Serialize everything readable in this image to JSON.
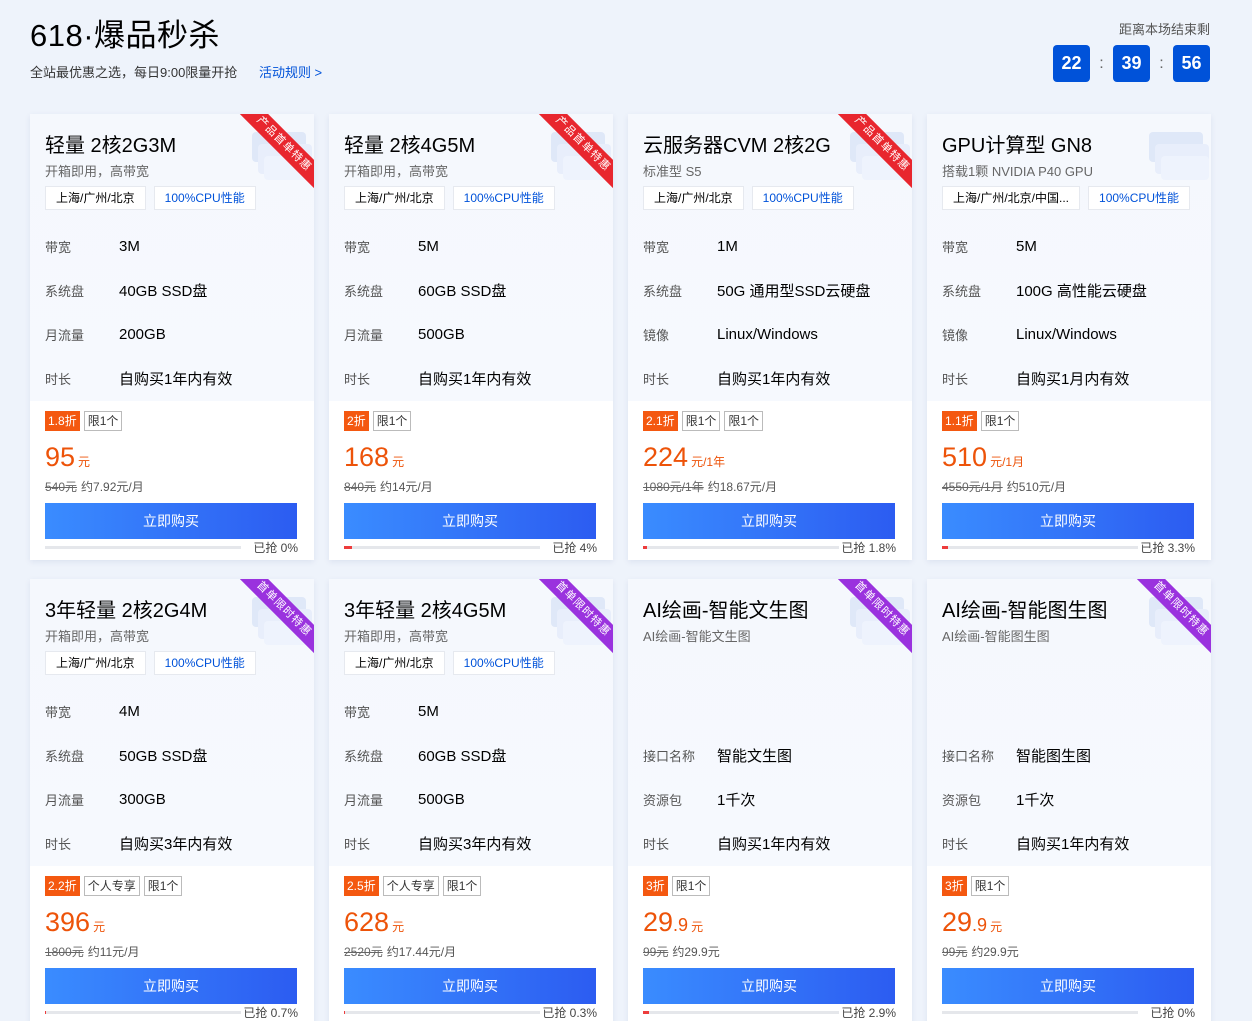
{
  "header": {
    "title": "618·爆品秒杀",
    "subtitle": "全站最优惠之选，每日9:00限量开抢",
    "rules_link": "活动规则 >",
    "countdown_label": "距离本场结束剩",
    "countdown": [
      "22",
      "39",
      "56"
    ],
    "countdown_sep": ":"
  },
  "labels": {
    "buy": "立即购买"
  },
  "cards": [
    {
      "title": "轻量 2核2G3M",
      "subtitle": "开箱即用，高带宽",
      "tags": [
        "上海/广州/北京",
        "100%CPU性能"
      ],
      "ribbon": "产品首单特惠",
      "ribbon_color": "red",
      "specs": [
        [
          "带宽",
          "3M"
        ],
        [
          "系统盘",
          "40GB SSD盘"
        ],
        [
          "月流量",
          "200GB"
        ],
        [
          "时长",
          "自购买1年内有效"
        ]
      ],
      "discount": "1.8折",
      "limits": [
        "限1个"
      ],
      "price": "95",
      "price_dec": "",
      "unit": "元",
      "orig": "540元",
      "monthly": "约7.92元/月",
      "sold_text": "已抢 0%",
      "sold_pct": 0
    },
    {
      "title": "轻量 2核4G5M",
      "subtitle": "开箱即用，高带宽",
      "tags": [
        "上海/广州/北京",
        "100%CPU性能"
      ],
      "ribbon": "产品首单特惠",
      "ribbon_color": "red",
      "specs": [
        [
          "带宽",
          "5M"
        ],
        [
          "系统盘",
          "60GB SSD盘"
        ],
        [
          "月流量",
          "500GB"
        ],
        [
          "时长",
          "自购买1年内有效"
        ]
      ],
      "discount": "2折",
      "limits": [
        "限1个"
      ],
      "price": "168",
      "price_dec": "",
      "unit": "元",
      "orig": "840元",
      "monthly": "约14元/月",
      "sold_text": "已抢 4%",
      "sold_pct": 4
    },
    {
      "title": "云服务器CVM 2核2G",
      "subtitle": "标准型 S5",
      "tags": [
        "上海/广州/北京",
        "100%CPU性能"
      ],
      "ribbon": "产品首单特惠",
      "ribbon_color": "red",
      "specs": [
        [
          "带宽",
          "1M"
        ],
        [
          "系统盘",
          "50G 通用型SSD云硬盘"
        ],
        [
          "镜像",
          "Linux/Windows"
        ],
        [
          "时长",
          "自购买1年内有效"
        ]
      ],
      "discount": "2.1折",
      "limits": [
        "限1个",
        "限1个"
      ],
      "price": "224",
      "price_dec": "",
      "unit": "元/1年",
      "orig": "1080元/1年",
      "monthly": "约18.67元/月",
      "sold_text": "已抢 1.8%",
      "sold_pct": 1.8
    },
    {
      "title": "GPU计算型 GN8",
      "subtitle": "搭载1颗 NVIDIA P40 GPU",
      "tags": [
        "上海/广州/北京/中国...",
        "100%CPU性能"
      ],
      "ribbon": "",
      "ribbon_color": "",
      "specs": [
        [
          "带宽",
          "5M"
        ],
        [
          "系统盘",
          "100G 高性能云硬盘"
        ],
        [
          "镜像",
          "Linux/Windows"
        ],
        [
          "时长",
          "自购买1月内有效"
        ]
      ],
      "discount": "1.1折",
      "limits": [
        "限1个"
      ],
      "price": "510",
      "price_dec": "",
      "unit": "元/1月",
      "orig": "4550元/1月",
      "monthly": "约510元/月",
      "sold_text": "已抢 3.3%",
      "sold_pct": 3.3
    },
    {
      "title": "3年轻量 2核2G4M",
      "subtitle": "开箱即用，高带宽",
      "tags": [
        "上海/广州/北京",
        "100%CPU性能"
      ],
      "ribbon": "首单限时特惠",
      "ribbon_color": "purple",
      "specs": [
        [
          "带宽",
          "4M"
        ],
        [
          "系统盘",
          "50GB SSD盘"
        ],
        [
          "月流量",
          "300GB"
        ],
        [
          "时长",
          "自购买3年内有效"
        ]
      ],
      "discount": "2.2折",
      "limits": [
        "个人专享",
        "限1个"
      ],
      "price": "396",
      "price_dec": "",
      "unit": "元",
      "orig": "1800元",
      "monthly": "约11元/月",
      "sold_text": "已抢 0.7%",
      "sold_pct": 0.7
    },
    {
      "title": "3年轻量 2核4G5M",
      "subtitle": "开箱即用，高带宽",
      "tags": [
        "上海/广州/北京",
        "100%CPU性能"
      ],
      "ribbon": "首单限时特惠",
      "ribbon_color": "purple",
      "specs": [
        [
          "带宽",
          "5M"
        ],
        [
          "系统盘",
          "60GB SSD盘"
        ],
        [
          "月流量",
          "500GB"
        ],
        [
          "时长",
          "自购买3年内有效"
        ]
      ],
      "discount": "2.5折",
      "limits": [
        "个人专享",
        "限1个"
      ],
      "price": "628",
      "price_dec": "",
      "unit": "元",
      "orig": "2520元",
      "monthly": "约17.44元/月",
      "sold_text": "已抢 0.3%",
      "sold_pct": 0.3
    },
    {
      "title": "AI绘画-智能文生图",
      "subtitle": "AI绘画-智能文生图",
      "tags": [],
      "ribbon": "首单限时特惠",
      "ribbon_color": "purple",
      "specs": [
        [
          "接口名称",
          "智能文生图"
        ],
        [
          "资源包",
          "1千次"
        ],
        [
          "时长",
          "自购买1年内有效"
        ]
      ],
      "discount": "3折",
      "limits": [
        "限1个"
      ],
      "price": "29",
      "price_dec": ".9",
      "unit": "元",
      "orig": "99元",
      "monthly": "约29.9元",
      "sold_text": "已抢 2.9%",
      "sold_pct": 2.9
    },
    {
      "title": "AI绘画-智能图生图",
      "subtitle": "AI绘画-智能图生图",
      "tags": [],
      "ribbon": "首单限时特惠",
      "ribbon_color": "purple",
      "specs": [
        [
          "接口名称",
          "智能图生图"
        ],
        [
          "资源包",
          "1千次"
        ],
        [
          "时长",
          "自购买1年内有效"
        ]
      ],
      "discount": "3折",
      "limits": [
        "限1个"
      ],
      "price": "29",
      "price_dec": ".9",
      "unit": "元",
      "orig": "99元",
      "monthly": "约29.9元",
      "sold_text": "已抢 0%",
      "sold_pct": 0
    }
  ]
}
